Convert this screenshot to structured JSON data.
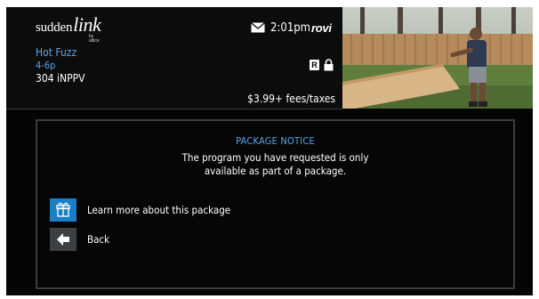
{
  "brand": {
    "logo_main_1": "sudden",
    "logo_main_2": "link",
    "logo_sub": "by altice"
  },
  "status_bar": {
    "time": "2:01pm",
    "provider": "rovi",
    "mail_icon": "envelope-icon"
  },
  "program": {
    "title": "Hot Fuzz",
    "time": "4-6p",
    "channel": "304 iNPPV",
    "rating": "R",
    "lock_icon": "lock-icon",
    "fees": "$3.99+ fees/taxes"
  },
  "dialog": {
    "title": "PACKAGE NOTICE",
    "body_line_1": "The program you have requested is only",
    "body_line_2": "available as part of a package.",
    "options": [
      {
        "label": "Learn more about this package",
        "icon": "gift-icon"
      },
      {
        "label": "Back",
        "icon": "arrow-left-icon"
      }
    ]
  },
  "colors": {
    "accent_blue": "#5aa6e8",
    "selected_option": "#1b7fc6",
    "panel_border": "#3a3c40"
  }
}
